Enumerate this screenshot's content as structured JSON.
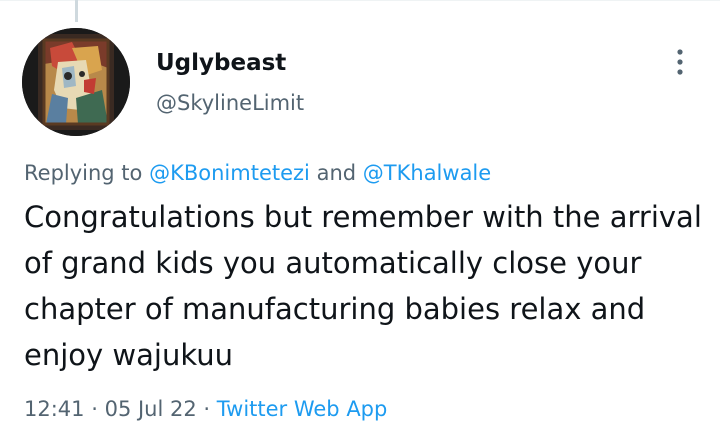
{
  "tweet": {
    "author": {
      "display_name": "Uglybeast",
      "handle": "@SkylineLimit",
      "avatar_icon": "painted-portrait-avatar"
    },
    "more_icon": "more-vertical-icon",
    "replying": {
      "prefix": "Replying to",
      "mention_1": "@KBonimtetezi",
      "conjunction": "and",
      "mention_2": "@TKhalwale"
    },
    "text": "Congratulations but remember with the arrival of grand kids you automatically close your chapter of manufacturing babies relax and enjoy wajukuu",
    "time": "12:41",
    "separator": "·",
    "date": "05 Jul 22",
    "source": "Twitter Web App"
  },
  "colors": {
    "text_primary": "#0f1419",
    "text_secondary": "#536471",
    "link": "#1d9bf0",
    "thread_line": "#cfd9de"
  }
}
